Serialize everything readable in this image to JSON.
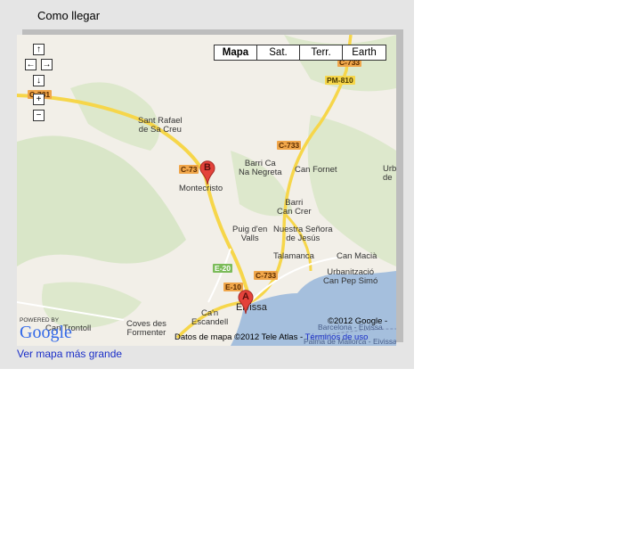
{
  "section_title": "Como llegar",
  "map_link": "Ver mapa más grande",
  "map_types": [
    "Mapa",
    "Sat.",
    "Terr.",
    "Earth"
  ],
  "controls": {
    "pan_up": "↑",
    "pan_left": "←",
    "pan_right": "→",
    "pan_down": "↓",
    "zoom_in": "+",
    "zoom_out": "−"
  },
  "places": [
    {
      "id": "sant-rafael",
      "text": "Sant Rafael\nde Sa Creu"
    },
    {
      "id": "barri-ca-na-negreta",
      "text": "Barri Ca\nNa Negreta"
    },
    {
      "id": "can-fornet",
      "text": "Can Fornet"
    },
    {
      "id": "montecristo",
      "text": "Montecristo"
    },
    {
      "id": "barri-can-crer",
      "text": "Barri\nCan Crer"
    },
    {
      "id": "puig-den-valls",
      "text": "Puig d'en\nValls"
    },
    {
      "id": "nuestra-senora",
      "text": "Nuestra Señora\nde Jesús"
    },
    {
      "id": "talamanca",
      "text": "Talamanca"
    },
    {
      "id": "can-macia",
      "text": "Can Macià"
    },
    {
      "id": "urbanitzacio",
      "text": "Urbanització\nCan Pep Simó"
    },
    {
      "id": "can-escandell",
      "text": "Ca'n\nEscandell"
    },
    {
      "id": "coves-des-formenter",
      "text": "Coves des\nFormenter"
    },
    {
      "id": "eivissa",
      "text": "Eivissa"
    },
    {
      "id": "can-trontoll",
      "text": "Can Trontoll"
    },
    {
      "id": "urb-edge",
      "text": "Urb\nde"
    }
  ],
  "roads": [
    "C-733",
    "PM-810",
    "C-733",
    "C-73",
    "E-20",
    "E-10",
    "C-733",
    "C-731"
  ],
  "markers": [
    "A",
    "B"
  ],
  "ferry_labels": [
    "Barcelona - Eivissa",
    "Palma de Mallorca - Eivissa"
  ],
  "attribution": {
    "powered_by": "POWERED BY",
    "logo": "Google",
    "copyright": "©2012 Google -",
    "map_data": "Datos de mapa ©2012 Tele Atlas -",
    "terms_link": "Términos de uso"
  },
  "colors": {
    "panel_bg": "#e5e5e5",
    "map_bg": "#f2efe8",
    "water": "#a5bfdd",
    "road_yellow": "#f6d64a",
    "road_orange": "#f0a64a",
    "marker_red": "#e4423b",
    "link_blue": "#1a2ec8"
  }
}
